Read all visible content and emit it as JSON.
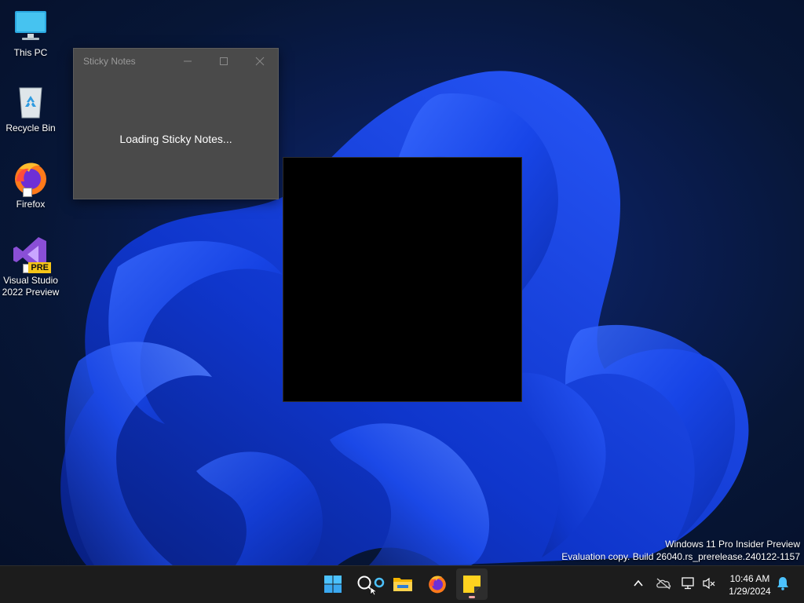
{
  "desktop": {
    "icons": [
      {
        "label": "This PC"
      },
      {
        "label": "Recycle Bin"
      },
      {
        "label": "Firefox"
      },
      {
        "label_line1": "Visual Studio",
        "label_line2": "2022 Preview",
        "badge": "PRE"
      }
    ],
    "watermark": {
      "line1": "Windows 11 Pro Insider Preview",
      "line2": "Evaluation copy. Build 26040.rs_prerelease.240122-1157"
    }
  },
  "sticky_window": {
    "title": "Sticky Notes",
    "loading_text": "Loading Sticky Notes..."
  },
  "taskbar": {
    "apps": [
      {
        "icon": "windows-start-icon"
      },
      {
        "icon": "search-icon"
      },
      {
        "icon": "file-explorer-icon"
      },
      {
        "icon": "firefox-icon"
      },
      {
        "icon": "sticky-notes-icon",
        "active": true
      }
    ],
    "tray": {
      "icons": [
        "chevron-up-icon",
        "onedrive-offline-icon",
        "network-icon",
        "volume-muted-icon",
        "notification-bell-icon"
      ],
      "time": "10:46 AM",
      "date": "1/29/2024"
    }
  },
  "colors": {
    "taskbar_bg": "#1c1c1c",
    "sticky_window_bg": "#4a4a4a",
    "wallpaper_blue": "#1a4dff",
    "sticky_yellow": "#ffd21f"
  }
}
